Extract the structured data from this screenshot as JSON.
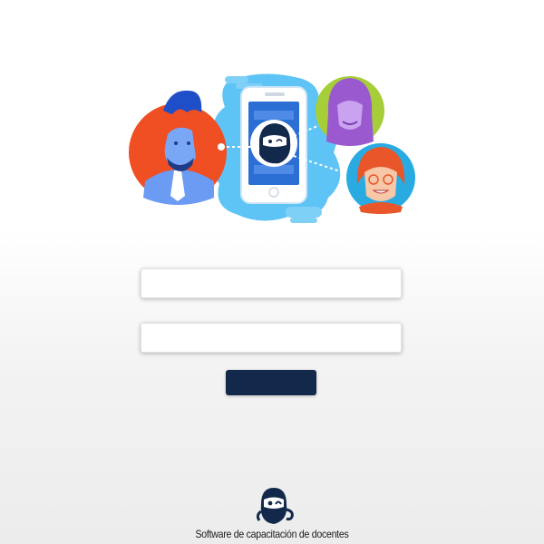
{
  "hero": {
    "illustration_icon": "phone-with-bot-connecting-people-illustration",
    "colors": {
      "accent_blue": "#3fa9f5",
      "man_background": "#f04e23",
      "woman_background": "#a6ce39",
      "girl_background": "#29abe2",
      "man_figure": "#5b8def"
    }
  },
  "login": {
    "username_value": "",
    "username_placeholder": "",
    "password_value": "",
    "password_placeholder": "",
    "submit_label": "",
    "submit_color": "#13294b"
  },
  "footer": {
    "logo_icon": "ninja-bot-logo-icon",
    "tagline": "Software de capacitación de docentes"
  }
}
